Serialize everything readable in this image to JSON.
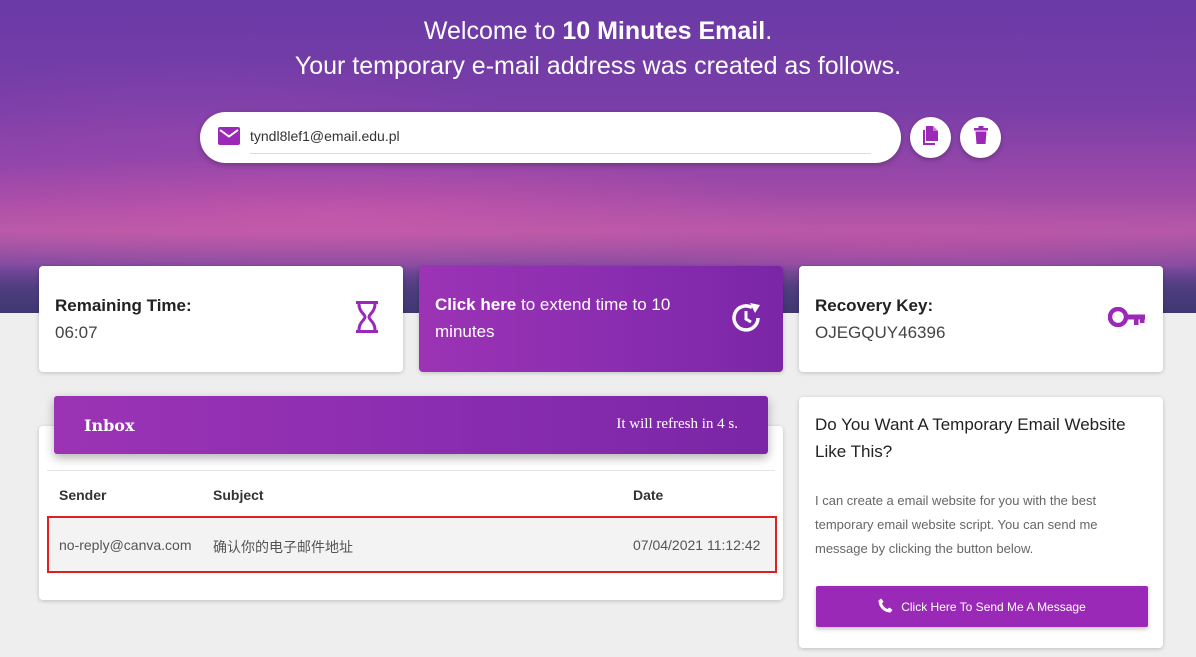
{
  "hero": {
    "welcome_prefix": "Welcome to ",
    "welcome_brand": "10 Minutes Email",
    "welcome_suffix": ".",
    "subtitle": "Your temporary e-mail address was created as follows."
  },
  "email": {
    "address": "tyndl8lef1@email.edu.pl",
    "icon": "mail-icon"
  },
  "actions": {
    "copy_icon": "copy-icon",
    "delete_icon": "trash-icon"
  },
  "timer": {
    "label": "Remaining Time:",
    "value": "06:07",
    "icon": "hourglass-icon"
  },
  "extend": {
    "bold": "Click here",
    "text": " to extend time to 10 minutes",
    "icon": "clock-refresh-icon"
  },
  "recovery": {
    "label": "Recovery Key:",
    "value": "OJEGQUY46396",
    "icon": "key-icon"
  },
  "inbox": {
    "title": "Inbox",
    "refresh": "It will refresh in 4 s.",
    "columns": [
      "Sender",
      "Subject",
      "Date"
    ],
    "rows": [
      {
        "sender": "no-reply@canva.com",
        "subject": "确认你的电子邮件地址",
        "date": "07/04/2021 11:12:42"
      }
    ]
  },
  "promo": {
    "title": "Do You Want A Temporary Email Website Like This?",
    "text": "I can create a email website for you with the best temporary email website script. You can send me message by clicking the button below.",
    "button": "Click Here To Send Me A Message",
    "button_icon": "phone-icon"
  },
  "colors": {
    "accent": "#9b29b8",
    "highlight_border": "#e02020"
  }
}
